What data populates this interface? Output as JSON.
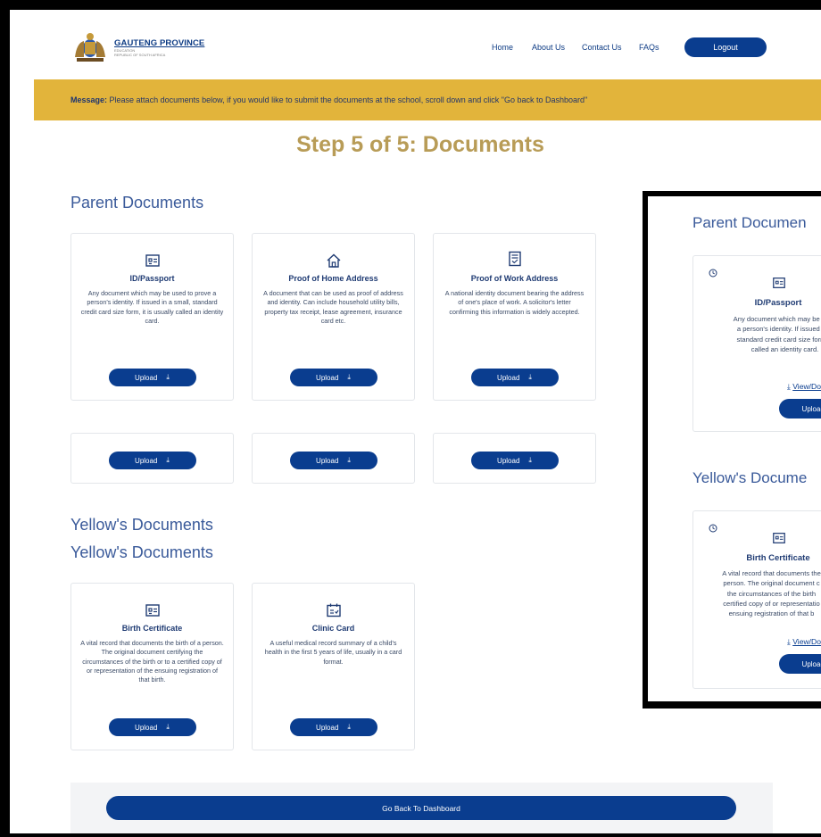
{
  "header": {
    "logo_title": "GAUTENG PROVINCE",
    "logo_sub1": "EDUCATION",
    "logo_sub2": "REPUBLIC OF SOUTH AFRICA",
    "nav": [
      "Home",
      "About Us",
      "Contact Us",
      "FAQs"
    ],
    "logout_label": "Logout"
  },
  "message": {
    "label": "Message:",
    "text": " Please attach documents below, if you would like to submit the documents at the school, scroll down and click \"Go back to Dashboard\""
  },
  "step_title": "Step 5 of 5: Documents",
  "parent_section": {
    "title": "Parent Documents",
    "cards": [
      {
        "title": "ID/Passport",
        "icon": "id-card-icon",
        "desc": "Any document which may be used to prove a person's identity. If issued in a small, standard credit card size form, it is usually called an identity card.",
        "upload": "Upload"
      },
      {
        "title": "Proof of Home Address",
        "icon": "home-icon",
        "desc": "A document that can be used as proof of address and identity. Can include household utility bills, property tax receipt, lease agreement, insurance card etc.",
        "upload": "Upload"
      },
      {
        "title": "Proof of Work Address",
        "icon": "document-icon",
        "desc": "A national identity document bearing the address of one's place of work. A solicitor's letter confirming this information is widely accepted.",
        "upload": "Upload"
      }
    ],
    "extra_uploads": [
      "Upload",
      "Upload",
      "Upload"
    ]
  },
  "child_section": {
    "title1": "Yellow's Documents",
    "title2": "Yellow's Documents",
    "cards": [
      {
        "title": "Birth Certificate",
        "icon": "id-card-icon",
        "desc": "A vital record that documents the birth of a person. The original document certifying the circumstances of the birth or to a certified copy of or representation of the ensuing registration of that birth.",
        "upload": "Upload"
      },
      {
        "title": "Clinic Card",
        "icon": "calendar-icon",
        "desc": "A useful medical record summary of a child's health in the first 5 years of life, usually in a card format.",
        "upload": "Upload"
      }
    ]
  },
  "dashboard_button": "Go Back To Dashboard",
  "inset": {
    "parent_title": "Parent Documen",
    "child_title": "Yellow's Docume",
    "card1": {
      "title": "ID/Passport",
      "desc_lines": [
        "Any document which may be used",
        "a person's identity. If issued in a",
        "standard credit card size form, it",
        "called an identity card."
      ],
      "view": "View/Download",
      "upload": "Upload"
    },
    "card2": {
      "title": "Birth Certificate",
      "desc_lines": [
        "A vital record that documents the",
        "person. The original document c",
        "the circumstances of the birth",
        "certified copy of or representatio",
        "ensuing registration of that b"
      ],
      "view": "View/Download",
      "upload": "Upload"
    }
  },
  "colors": {
    "primary": "#0a3d8f",
    "message_bg": "#e2b43b",
    "step_title": "#b89c57"
  }
}
